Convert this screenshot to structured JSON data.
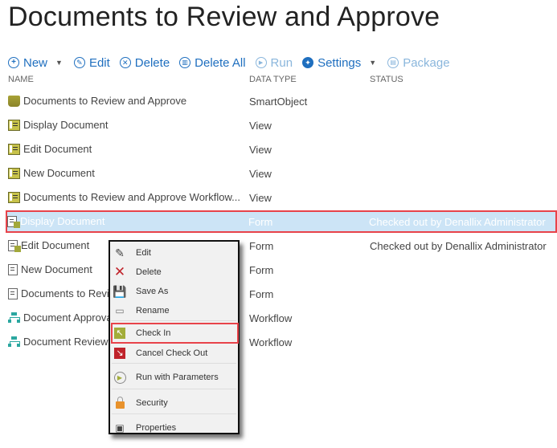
{
  "page": {
    "title": "Documents to Review and Approve"
  },
  "toolbar": {
    "new_label": "New",
    "edit_label": "Edit",
    "delete_label": "Delete",
    "delete_all_label": "Delete All",
    "run_label": "Run",
    "settings_label": "Settings",
    "package_label": "Package"
  },
  "columns": {
    "name": "NAME",
    "data_type": "DATA TYPE",
    "status": "STATUS"
  },
  "rows": [
    {
      "name": "Documents to Review and Approve",
      "type": "SmartObject",
      "status": "",
      "icon": "smartobject-icon"
    },
    {
      "name": "Display Document",
      "type": "View",
      "status": "",
      "icon": "view-icon"
    },
    {
      "name": "Edit Document",
      "type": "View",
      "status": "",
      "icon": "view-icon"
    },
    {
      "name": "New Document",
      "type": "View",
      "status": "",
      "icon": "view-icon"
    },
    {
      "name": "Documents to Review and Approve Workflow...",
      "type": "View",
      "status": "",
      "icon": "view-icon"
    },
    {
      "name": "Display Document",
      "type": "Form",
      "status": "Checked out by Denallix Administrator",
      "icon": "form-checked-out-icon",
      "selected": true
    },
    {
      "name": "Edit Document",
      "type": "Form",
      "status": "Checked out by Denallix Administrator",
      "icon": "form-checked-out-icon"
    },
    {
      "name": "New Document",
      "type": "Form",
      "status": "",
      "icon": "form-icon"
    },
    {
      "name": "Documents to Review and Approve",
      "type": "Form",
      "status": "",
      "icon": "form-icon"
    },
    {
      "name": "Document Approval",
      "type": "Workflow",
      "status": "",
      "icon": "workflow-icon"
    },
    {
      "name": "Document Review",
      "type": "Workflow",
      "status": "",
      "icon": "workflow-icon"
    }
  ],
  "context_menu": {
    "items": [
      {
        "label": "Edit",
        "icon": "pencil-icon"
      },
      {
        "label": "Delete",
        "icon": "delete-x-icon"
      },
      {
        "label": "Save As",
        "icon": "save-as-icon"
      },
      {
        "label": "Rename",
        "icon": "rename-icon"
      },
      {
        "label": "Check In",
        "icon": "check-in-icon",
        "highlighted": true
      },
      {
        "label": "Cancel Check Out",
        "icon": "cancel-check-out-icon"
      },
      {
        "label": "Run with Parameters",
        "icon": "run-parameters-icon"
      },
      {
        "label": "Security",
        "icon": "lock-icon"
      },
      {
        "label": "Properties",
        "icon": "properties-icon"
      }
    ]
  },
  "colors": {
    "accent": "#1f6fbf",
    "selection": "#cce4f6",
    "highlight_border": "#e8434a"
  }
}
